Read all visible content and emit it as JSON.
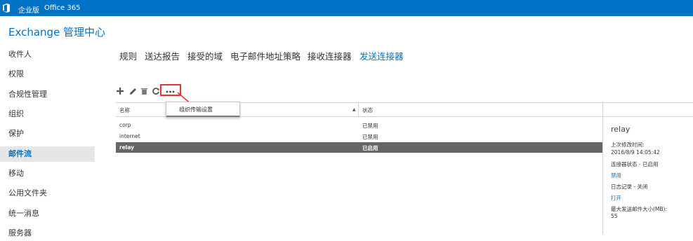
{
  "topbar": {
    "edition": "企业版",
    "product": "Office 365",
    "bg_color": "#0072c6",
    "logo_icon": "office-logo-icon"
  },
  "app": {
    "title": "Exchange 管理中心"
  },
  "sidebar": {
    "items": [
      {
        "label": "收件人",
        "selected": false
      },
      {
        "label": "权限",
        "selected": false
      },
      {
        "label": "合规性管理",
        "selected": false
      },
      {
        "label": "组织",
        "selected": false
      },
      {
        "label": "保护",
        "selected": false
      },
      {
        "label": "邮件流",
        "selected": true
      },
      {
        "label": "移动",
        "selected": false
      },
      {
        "label": "公用文件夹",
        "selected": false
      },
      {
        "label": "统一消息",
        "selected": false
      },
      {
        "label": "服务器",
        "selected": false
      }
    ]
  },
  "tabs": [
    {
      "label": "规则",
      "active": false
    },
    {
      "label": "送达报告",
      "active": false
    },
    {
      "label": "接受的域",
      "active": false
    },
    {
      "label": "电子邮件地址策略",
      "active": false
    },
    {
      "label": "接收连接器",
      "active": false
    },
    {
      "label": "发送连接器",
      "active": true
    }
  ],
  "toolbar": {
    "icons": [
      "add-icon",
      "edit-icon",
      "delete-icon",
      "refresh-icon",
      "more-icon"
    ],
    "highlight_color": "#e8342c"
  },
  "dropdown": {
    "item_label": "组织传输设置"
  },
  "table": {
    "columns": [
      "名称",
      "状态"
    ],
    "rows": [
      {
        "name": "corp",
        "status": "已禁用",
        "selected": false
      },
      {
        "name": "internet",
        "status": "已禁用",
        "selected": false
      },
      {
        "name": "relay",
        "status": "已启用",
        "selected": true
      }
    ]
  },
  "details": {
    "name": "relay",
    "modified_label": "上次修改时间:",
    "modified_value": "2016/8/9 14:05:42",
    "connector_status": "连接器状态 - 已启用",
    "disable_link": "禁用",
    "logging_status": "日志记录 - 关闭",
    "enable_link": "打开",
    "max_size_label": "最大发送邮件大小(MB):",
    "max_size_value": "55"
  },
  "colors": {
    "accent": "#0072c6",
    "selected_row": "#666666",
    "selected_nav_bg": "#e6e6e6"
  }
}
